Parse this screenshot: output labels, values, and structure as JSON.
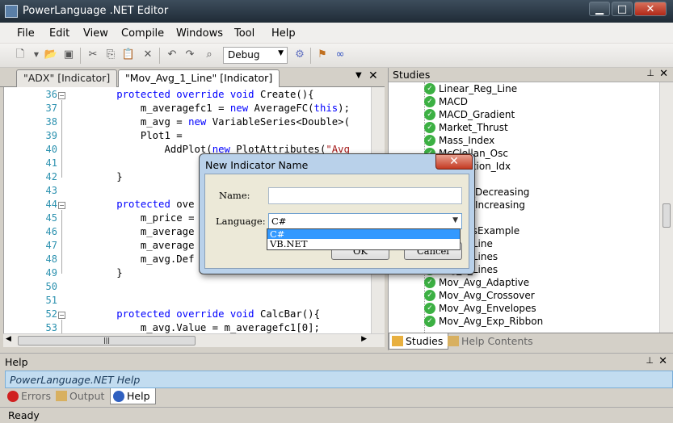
{
  "window": {
    "title": "PowerLanguage .NET Editor",
    "minimize": "▁",
    "maximize": "□",
    "close": "✕"
  },
  "menu": [
    "File",
    "Edit",
    "View",
    "Compile",
    "Windows",
    "Tool",
    "Help"
  ],
  "toolbar": {
    "config": "Debug"
  },
  "doc_tabs": [
    {
      "label": "\"ADX\" [Indicator]"
    },
    {
      "label": "\"Mov_Avg_1_Line\" [Indicator]"
    }
  ],
  "editor": {
    "lines": [
      {
        "n": "36",
        "t": "        protected override void Create(){"
      },
      {
        "n": "37",
        "t": "            m_averagefc1 = new AverageFC(this);"
      },
      {
        "n": "38",
        "t": "            m_avg = new VariableSeries<Double>("
      },
      {
        "n": "39",
        "t": "            Plot1 ="
      },
      {
        "n": "40",
        "t": "                AddPlot(new PlotAttributes(\"Avg"
      },
      {
        "n": "41",
        "t": ""
      },
      {
        "n": "42",
        "t": "        }"
      },
      {
        "n": "43",
        "t": ""
      },
      {
        "n": "44",
        "t": "        protected ove"
      },
      {
        "n": "45",
        "t": "            m_price ="
      },
      {
        "n": "46",
        "t": "            m_average"
      },
      {
        "n": "47",
        "t": "            m_average"
      },
      {
        "n": "48",
        "t": "            m_avg.Def"
      },
      {
        "n": "49",
        "t": "        }"
      },
      {
        "n": "50",
        "t": ""
      },
      {
        "n": "51",
        "t": ""
      },
      {
        "n": "52",
        "t": "        protected override void CalcBar(){"
      },
      {
        "n": "53",
        "t": "            m_avg.Value = m_averagefc1[0];"
      }
    ]
  },
  "studies": {
    "title": "Studies",
    "items": [
      "Linear_Reg_Line",
      "MACD",
      "MACD_Gradient",
      "Market_Thrust",
      "Mass_Index",
      "McClellan_Osc",
      "Facilitation_Idx",
      "entum",
      "entum_Decreasing",
      "entum_Increasing",
      "y_Flow",
      "eEventsExample",
      "Avg_1_Line",
      "Avg_2_Lines",
      "Avg_3_Lines",
      "Mov_Avg_Adaptive",
      "Mov_Avg_Crossover",
      "Mov_Avg_Envelopes",
      "Mov_Avg_Exp_Ribbon"
    ],
    "tabs": [
      "Studies",
      "Help Contents"
    ]
  },
  "help": {
    "title": "Help",
    "link": "PowerLanguage.NET Help",
    "tabs": [
      "Errors",
      "Output",
      "Help"
    ]
  },
  "status": "Ready",
  "dialog": {
    "title": "New Indicator Name",
    "name_label": "Name:",
    "name_value": "",
    "language_label": "Language:",
    "language_value": "C#",
    "options": [
      "C#",
      "VB.NET"
    ],
    "ok": "OK",
    "cancel": "Cancel"
  }
}
